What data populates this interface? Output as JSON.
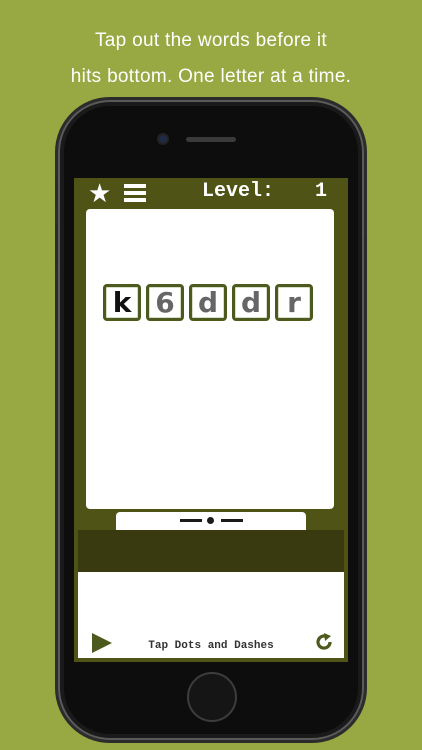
{
  "caption": {
    "line1": "Tap out the words before it",
    "line2": "hits bottom.  One letter at a time."
  },
  "game": {
    "level_label": "Level:",
    "level_value": "1",
    "tiles": [
      "k",
      "6",
      "d",
      "d",
      "r"
    ],
    "hint": "Tap Dots and Dashes"
  },
  "icons": {
    "favorite": "star-icon",
    "menu": "hamburger-menu-icon",
    "play": "play-icon",
    "reset": "reset-icon"
  },
  "colors": {
    "background": "#98a842",
    "screen": "#4f5416",
    "tile_border": "#4d5a1e"
  }
}
